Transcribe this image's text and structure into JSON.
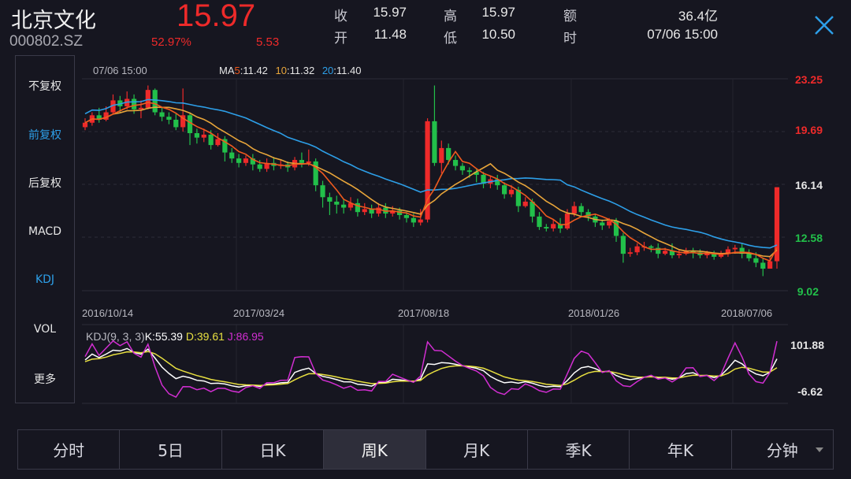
{
  "header": {
    "name": "北京文化",
    "code": "000802.SZ",
    "price": "15.97",
    "change_pct": "52.97%",
    "change_val": "5.53",
    "quote": [
      {
        "label": "收",
        "value": "15.97"
      },
      {
        "label": "高",
        "value": "15.97"
      },
      {
        "label": "额",
        "value": "36.4亿"
      },
      {
        "label": "开",
        "value": "11.48"
      },
      {
        "label": "低",
        "value": "10.50"
      },
      {
        "label": "时",
        "value": "07/06 15:00"
      }
    ]
  },
  "sidebar": {
    "items": [
      {
        "label": "不复权",
        "active": false
      },
      {
        "label": "前复权",
        "active": true
      },
      {
        "label": "后复权",
        "active": false
      },
      {
        "label": "MACD",
        "active": false
      },
      {
        "label": "KDJ",
        "active": true
      },
      {
        "label": "VOL",
        "active": false
      },
      {
        "label": "更多",
        "active": false
      }
    ]
  },
  "chart_info": {
    "date": "07/06 15:00",
    "ma5_label": "MA",
    "ma5_key": "5",
    "ma5_val": ":11.42",
    "ma10_key": "10",
    "ma10_val": ":11.32",
    "ma20_key": "20",
    "ma20_val": ":11.40"
  },
  "price_axis": [
    "23.25",
    "19.69",
    "16.14",
    "12.58",
    "9.02"
  ],
  "dates": [
    "2016/10/14",
    "2017/03/24",
    "2017/08/18",
    "2018/01/26",
    "2018/07/06"
  ],
  "kdj": {
    "label": "KDJ(9, 3, 3)",
    "k": "K:55.39",
    "d": "D:39.61",
    "j": "J:86.95",
    "axis_top": "101.88",
    "axis_bottom": "-6.62"
  },
  "tabs": [
    {
      "label": "分时",
      "active": false
    },
    {
      "label": "5日",
      "active": false
    },
    {
      "label": "日K",
      "active": false
    },
    {
      "label": "周K",
      "active": true
    },
    {
      "label": "月K",
      "active": false
    },
    {
      "label": "季K",
      "active": false
    },
    {
      "label": "年K",
      "active": false
    },
    {
      "label": "分钟",
      "active": false,
      "dropdown": true
    }
  ],
  "colors": {
    "up": "#ee2a2a",
    "down": "#22c04a",
    "ma5": "#f05a1e",
    "ma10": "#e8a53a",
    "ma20": "#2d9fe8",
    "k": "#ffffff",
    "d": "#e8e040",
    "j": "#d22ed2",
    "accent": "#2d9fe8"
  },
  "chart_data": {
    "type": "candlestick",
    "y_range": [
      9.02,
      23.25
    ],
    "candles": [
      [
        20.0,
        20.3,
        20.6,
        19.8
      ],
      [
        20.3,
        20.8,
        21.0,
        20.1
      ],
      [
        20.8,
        20.5,
        21.3,
        20.3
      ],
      [
        20.5,
        21.0,
        21.4,
        20.4
      ],
      [
        21.0,
        21.8,
        22.2,
        20.9
      ],
      [
        21.8,
        21.4,
        22.1,
        21.0
      ],
      [
        21.4,
        21.9,
        22.4,
        21.2
      ],
      [
        21.9,
        21.2,
        22.2,
        20.9
      ],
      [
        21.2,
        21.3,
        21.8,
        20.6
      ],
      [
        21.3,
        22.5,
        22.8,
        21.2
      ],
      [
        22.5,
        21.0,
        22.6,
        20.8
      ],
      [
        21.0,
        20.7,
        21.3,
        20.4
      ],
      [
        20.7,
        20.5,
        21.0,
        20.2
      ],
      [
        20.5,
        20.0,
        20.9,
        19.8
      ],
      [
        20.0,
        20.8,
        22.6,
        19.7
      ],
      [
        20.8,
        19.6,
        21.0,
        18.8
      ],
      [
        19.6,
        19.3,
        19.9,
        18.9
      ],
      [
        19.3,
        19.5,
        19.9,
        19.0
      ],
      [
        19.5,
        18.8,
        19.8,
        18.5
      ],
      [
        18.8,
        19.2,
        19.6,
        18.7
      ],
      [
        19.2,
        18.3,
        19.4,
        17.7
      ],
      [
        18.3,
        17.9,
        18.6,
        17.6
      ],
      [
        17.9,
        17.6,
        18.2,
        17.3
      ],
      [
        17.6,
        17.9,
        18.1,
        17.4
      ],
      [
        17.9,
        17.5,
        18.2,
        17.1
      ],
      [
        17.5,
        17.2,
        17.8,
        17.0
      ],
      [
        17.2,
        17.6,
        17.9,
        17.0
      ],
      [
        17.6,
        17.4,
        18.0,
        17.1
      ],
      [
        17.4,
        17.5,
        17.8,
        17.2
      ],
      [
        17.5,
        17.3,
        17.7,
        17.0
      ],
      [
        17.3,
        17.8,
        18.0,
        17.1
      ],
      [
        17.8,
        17.6,
        18.3,
        17.3
      ],
      [
        17.6,
        17.7,
        18.5,
        17.4
      ],
      [
        17.7,
        16.1,
        17.9,
        15.7
      ],
      [
        16.1,
        15.3,
        16.4,
        14.6
      ],
      [
        15.3,
        15.0,
        15.6,
        14.1
      ],
      [
        15.0,
        14.8,
        15.4,
        14.2
      ],
      [
        14.8,
        14.6,
        15.2,
        14.2
      ],
      [
        14.6,
        14.9,
        15.3,
        14.4
      ],
      [
        14.9,
        14.3,
        15.2,
        14.0
      ],
      [
        14.3,
        14.5,
        14.9,
        14.1
      ],
      [
        14.5,
        14.2,
        14.8,
        13.9
      ],
      [
        14.2,
        14.6,
        14.9,
        14.0
      ],
      [
        14.6,
        14.2,
        14.9,
        13.9
      ],
      [
        14.2,
        14.4,
        14.7,
        14.0
      ],
      [
        14.4,
        14.1,
        14.6,
        13.8
      ],
      [
        14.1,
        13.9,
        14.3,
        13.6
      ],
      [
        13.9,
        13.6,
        14.2,
        13.3
      ],
      [
        13.6,
        13.8,
        14.5,
        13.4
      ],
      [
        13.8,
        20.4,
        20.6,
        13.6
      ],
      [
        20.4,
        17.6,
        22.8,
        17.4
      ],
      [
        17.6,
        18.6,
        19.1,
        16.9
      ],
      [
        18.6,
        17.8,
        18.9,
        17.5
      ],
      [
        17.8,
        17.4,
        18.1,
        17.1
      ],
      [
        17.4,
        17.1,
        17.6,
        16.8
      ],
      [
        17.1,
        17.0,
        17.3,
        16.6
      ],
      [
        17.0,
        16.8,
        17.2,
        16.3
      ],
      [
        16.8,
        16.2,
        17.0,
        15.9
      ],
      [
        16.2,
        16.5,
        16.7,
        15.9
      ],
      [
        16.5,
        16.1,
        16.8,
        15.8
      ],
      [
        16.1,
        15.5,
        16.3,
        15.2
      ],
      [
        15.5,
        15.8,
        16.1,
        15.3
      ],
      [
        15.8,
        14.7,
        16.0,
        14.3
      ],
      [
        14.7,
        15.0,
        15.3,
        14.6
      ],
      [
        15.0,
        14.0,
        15.2,
        13.6
      ],
      [
        14.0,
        13.3,
        14.3,
        13.1
      ],
      [
        13.3,
        13.2,
        13.5,
        13.0
      ],
      [
        13.2,
        13.5,
        13.8,
        13.0
      ],
      [
        13.5,
        13.2,
        13.9,
        12.9
      ],
      [
        13.2,
        14.2,
        14.5,
        13.1
      ],
      [
        14.2,
        14.7,
        15.0,
        14.0
      ],
      [
        14.7,
        14.3,
        14.9,
        14.0
      ],
      [
        14.3,
        14.0,
        14.5,
        13.7
      ],
      [
        14.0,
        13.6,
        14.2,
        13.3
      ],
      [
        13.6,
        13.4,
        13.8,
        13.1
      ],
      [
        13.4,
        13.7,
        13.9,
        13.2
      ],
      [
        13.7,
        12.7,
        13.9,
        12.3
      ],
      [
        12.7,
        11.5,
        12.9,
        10.9
      ],
      [
        11.5,
        11.6,
        11.9,
        11.3
      ],
      [
        11.6,
        12.0,
        12.2,
        11.4
      ],
      [
        12.0,
        12.0,
        12.3,
        11.7
      ],
      [
        12.0,
        11.9,
        12.1,
        11.6
      ],
      [
        11.9,
        11.5,
        12.2,
        11.2
      ],
      [
        11.5,
        11.7,
        11.9,
        11.4
      ],
      [
        11.7,
        11.4,
        12.2,
        11.2
      ],
      [
        11.4,
        11.5,
        11.8,
        11.2
      ],
      [
        11.5,
        11.7,
        11.9,
        11.4
      ],
      [
        11.7,
        11.6,
        11.9,
        11.2
      ],
      [
        11.6,
        11.4,
        11.8,
        11.2
      ],
      [
        11.4,
        11.5,
        11.7,
        11.2
      ],
      [
        11.5,
        11.3,
        11.7,
        11.1
      ],
      [
        11.3,
        11.5,
        11.7,
        11.2
      ],
      [
        11.5,
        11.8,
        12.0,
        11.3
      ],
      [
        11.8,
        11.9,
        12.1,
        11.5
      ],
      [
        11.9,
        11.5,
        12.2,
        11.2
      ],
      [
        11.5,
        11.2,
        11.8,
        11.0
      ],
      [
        11.2,
        10.9,
        11.6,
        10.6
      ],
      [
        10.9,
        10.5,
        11.2,
        10.0
      ],
      [
        10.5,
        11.0,
        11.3,
        10.5
      ],
      [
        11.0,
        15.97,
        15.97,
        10.5
      ]
    ]
  }
}
